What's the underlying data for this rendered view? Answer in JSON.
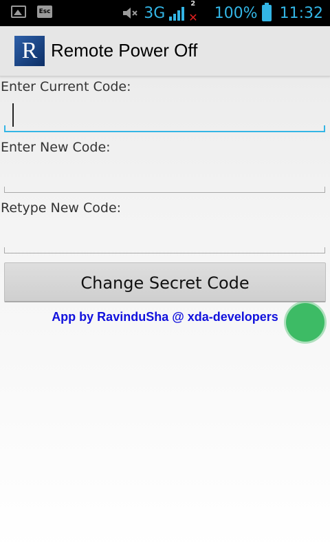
{
  "status_bar": {
    "network": "3G",
    "sim_badge": "2",
    "battery": "100%",
    "time": "11:32",
    "icons": [
      "image-icon",
      "esc-icon",
      "mute-icon",
      "signal-icon",
      "no-data-icon",
      "battery-icon"
    ],
    "accent_color": "#33b5e5"
  },
  "action_bar": {
    "logo_letter": "R",
    "title": "Remote Power Off"
  },
  "form": {
    "current_code_label": "Enter Current Code:",
    "current_code_value": "",
    "new_code_label": "Enter New Code:",
    "new_code_value": "",
    "retype_code_label": "Retype New Code:",
    "retype_code_value": "",
    "submit_label": "Change Secret Code"
  },
  "footer": {
    "credit": "App by RavinduSha @ xda-developers",
    "credit_color": "#1111dd"
  }
}
